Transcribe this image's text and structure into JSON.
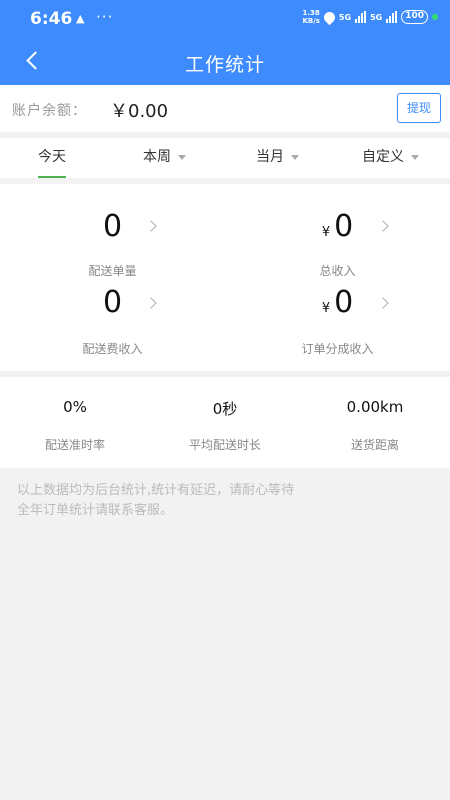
{
  "status_bar": {
    "time": "6:46",
    "notif": "▲",
    "dots": "···",
    "speed_value": "1.38",
    "speed_unit": "KB/s",
    "sig1": "5G",
    "sig2": "5G",
    "battery": "100",
    "icons": [
      "location-icon",
      "signal-icon",
      "battery-icon"
    ]
  },
  "nav": {
    "title": "工作统计",
    "back_icon": "chevron-left-icon"
  },
  "balance": {
    "label": "账户余额：",
    "amount": "￥0.00",
    "withdraw_label": "提现"
  },
  "tabs": [
    {
      "label": "今天",
      "active": true
    },
    {
      "label": "本周",
      "dropdown": true
    },
    {
      "label": "当月",
      "dropdown": true
    },
    {
      "label": "自定义",
      "dropdown": true
    }
  ],
  "stats": [
    {
      "value": "0",
      "label": "配送单量"
    },
    {
      "currency": "¥",
      "value": "0",
      "label": "总收入"
    },
    {
      "value": "0",
      "label": "配送费收入"
    },
    {
      "currency": "¥",
      "value": "0",
      "label": "订单分成收入"
    }
  ],
  "metrics": [
    {
      "value": "0%",
      "label": "配送准时率"
    },
    {
      "value": "0秒",
      "label": "平均配送时长"
    },
    {
      "value": "0.00km",
      "label": "送货距离"
    }
  ],
  "note": {
    "line1": "以上数据均为后台统计,统计有延迟，请耐心等待",
    "line2": "全年订单统计请联系客服。"
  },
  "colors": {
    "primary": "#3d8bfd",
    "tab_underline": "#4caf50",
    "background": "#f2f2f2"
  }
}
